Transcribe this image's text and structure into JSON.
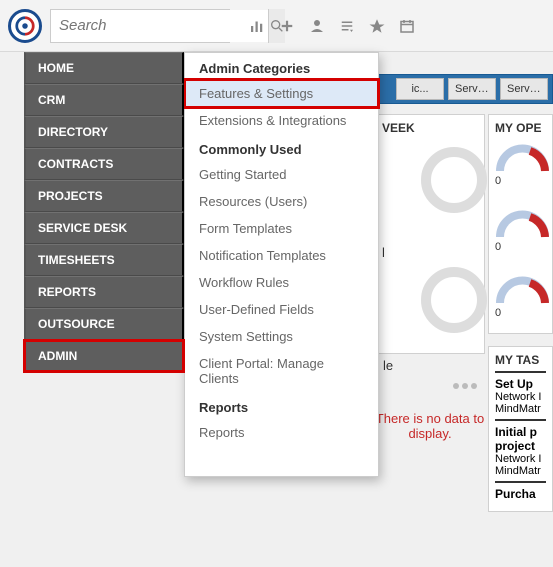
{
  "topbar": {
    "search_placeholder": "Search"
  },
  "sidebar": {
    "items": [
      {
        "label": "HOME"
      },
      {
        "label": "CRM"
      },
      {
        "label": "DIRECTORY"
      },
      {
        "label": "CONTRACTS"
      },
      {
        "label": "PROJECTS"
      },
      {
        "label": "SERVICE DESK"
      },
      {
        "label": "TIMESHEETS"
      },
      {
        "label": "REPORTS"
      },
      {
        "label": "OUTSOURCE"
      },
      {
        "label": "ADMIN"
      }
    ]
  },
  "flyout": {
    "sec1": "Admin Categories",
    "s1": [
      {
        "label": "Features & Settings"
      },
      {
        "label": "Extensions & Integrations"
      }
    ],
    "sec2": "Commonly Used",
    "s2": [
      {
        "label": "Getting Started"
      },
      {
        "label": "Resources (Users)"
      },
      {
        "label": "Form Templates"
      },
      {
        "label": "Notification Templates"
      },
      {
        "label": "Workflow Rules"
      },
      {
        "label": "User-Defined Fields"
      },
      {
        "label": "System Settings"
      },
      {
        "label": "Client Portal: Manage Clients"
      }
    ],
    "sec3": "Reports",
    "s3": [
      {
        "label": "Reports"
      }
    ]
  },
  "tabs": {
    "t0": "ic...",
    "t1": "Servic...",
    "t2": "Servic..."
  },
  "widgets": {
    "week_title": "VEEK",
    "week_sub1": "l",
    "week_sub2": "le",
    "open_title": "MY OPE",
    "gauge_val": "0",
    "tasks_title": "MY TAS",
    "task1_title": "Set Up",
    "task1_l1": "Network I",
    "task1_l2": "MindMatr",
    "task2_title": "Initial p",
    "task2_sub": "project",
    "task2_l1": "Network I",
    "task2_l2": "MindMatr",
    "purcha": "Purcha"
  },
  "nodata": "There is no data to display."
}
